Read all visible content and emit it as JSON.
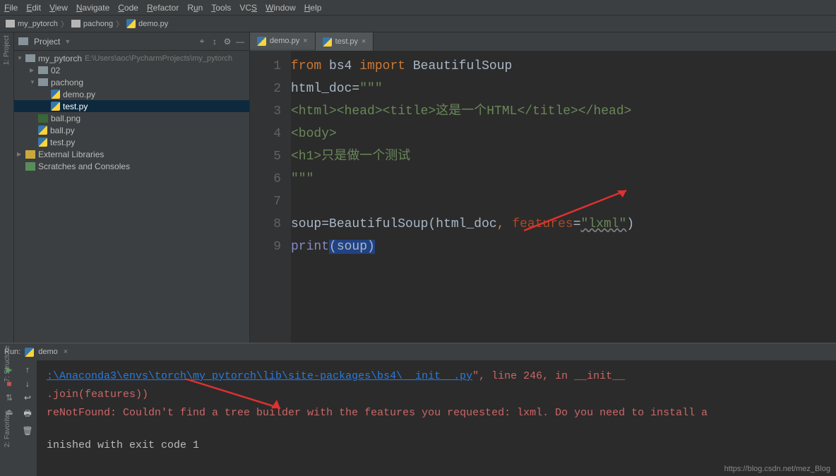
{
  "menu": {
    "file": "File",
    "edit": "Edit",
    "view": "View",
    "navigate": "Navigate",
    "code": "Code",
    "refactor": "Refactor",
    "run": "Run",
    "tools": "Tools",
    "vcs": "VCS",
    "window": "Window",
    "help": "Help"
  },
  "breadcrumb": {
    "root": "my_pytorch",
    "folder": "pachong",
    "file": "demo.py"
  },
  "project_panel": {
    "title": "Project",
    "tools": {
      "target": "⌖",
      "collapse": "↕",
      "gear": "⚙",
      "hide": "—"
    }
  },
  "tree": {
    "root": {
      "name": "my_pytorch",
      "path": "E:\\Users\\aoc\\PycharmProjects\\my_pytorch"
    },
    "folder02": "02",
    "pachong": "pachong",
    "files": {
      "demo": "demo.py",
      "test": "test.py"
    },
    "loose": {
      "ballpng": "ball.png",
      "ballpy": "ball.py",
      "testpy": "test.py"
    },
    "ext": "External Libraries",
    "scratch": "Scratches and Consoles"
  },
  "tabs": {
    "demo": "demo.py",
    "test": "test.py"
  },
  "code": {
    "lines": {
      "l1": {
        "from": "from",
        "mod": "bs4",
        "import": "import",
        "cls": "BeautifulSoup"
      },
      "l2": {
        "var": "html_doc",
        "eq": "=",
        "str": "\"\"\""
      },
      "l3": "<html><head><title>这是一个HTML</title></head>",
      "l4": "<body>",
      "l5": "<h1>只是做一个测试",
      "l6": "\"\"\"",
      "l8": {
        "var": "soup",
        "eq": "=",
        "cls": "BeautifulSoup",
        "open": "(",
        "arg1": "html_doc",
        "comma": ", ",
        "kw": "features",
        "eq2": "=",
        "v": "\"lxml\"",
        "close": ")"
      },
      "l9": {
        "fn": "print",
        "open": "(",
        "arg": "soup",
        "close": ")"
      }
    },
    "linenums": [
      "1",
      "2",
      "3",
      "4",
      "5",
      "6",
      "7",
      "8",
      "9"
    ]
  },
  "run": {
    "label": "Run:",
    "config": "demo",
    "out": {
      "path": ":\\Anaconda3\\envs\\torch\\my_pytorch\\lib\\site-packages\\bs4\\__init__.py",
      "pathtail": "\", line 246, in __init__",
      "l2": ".join(features))",
      "l3": "reNotFound: Couldn't find a tree builder with the features you requested: lxml. Do you need to install a",
      "l4": "inished with exit code 1"
    }
  },
  "sidetabs": {
    "project": "1: Project",
    "structure": "7: Structure",
    "favorites": "2: Favorites"
  },
  "watermark": "https://blog.csdn.net/mez_Blog"
}
